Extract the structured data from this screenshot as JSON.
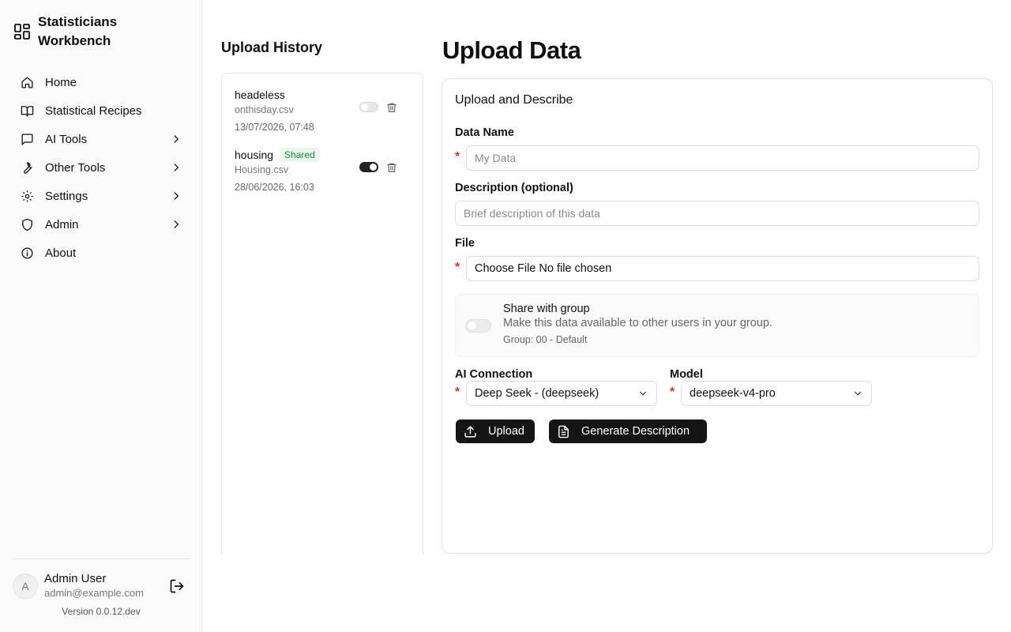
{
  "app": {
    "title": "Statisticians Workbench",
    "version": "Version 0.0.12.dev"
  },
  "sidebar": {
    "items": [
      {
        "label": "Home",
        "icon": "home-icon",
        "expandable": false
      },
      {
        "label": "Statistical Recipes",
        "icon": "book-icon",
        "expandable": false
      },
      {
        "label": "AI Tools",
        "icon": "chat-icon",
        "expandable": true
      },
      {
        "label": "Other Tools",
        "icon": "wrench-icon",
        "expandable": true
      },
      {
        "label": "Settings",
        "icon": "gear-icon",
        "expandable": true
      },
      {
        "label": "Admin",
        "icon": "shield-icon",
        "expandable": true
      },
      {
        "label": "About",
        "icon": "info-icon",
        "expandable": false
      }
    ]
  },
  "user": {
    "initial": "A",
    "name": "Admin User",
    "email": "admin@example.com"
  },
  "history": {
    "title": "Upload History",
    "items": [
      {
        "name": "headeless",
        "file": "onthisday.csv",
        "date": "13/07/2026, 07:48",
        "shared": false,
        "badge": ""
      },
      {
        "name": "housing",
        "file": "Housing.csv",
        "date": "28/06/2026, 16:03",
        "shared": true,
        "badge": "Shared"
      }
    ]
  },
  "main": {
    "title": "Upload Data",
    "card_title": "Upload and Describe",
    "data_name": {
      "label": "Data Name",
      "required_mark": "*",
      "placeholder": "My Data",
      "value": ""
    },
    "description": {
      "label": "Description (optional)",
      "placeholder": "Brief description of this data",
      "value": ""
    },
    "file": {
      "label": "File",
      "required_mark": "*",
      "button": "Choose File",
      "status": "No file chosen"
    },
    "share": {
      "title": "Share with group",
      "description": "Make this data available to other users in your group.",
      "group": "Group: 00 - Default",
      "enabled": false
    },
    "ai_connection": {
      "label": "AI Connection",
      "required_mark": "*",
      "value": "Deep Seek - (deepseek)"
    },
    "model": {
      "label": "Model",
      "required_mark": "*",
      "value": "deepseek-v4-pro"
    },
    "buttons": {
      "upload": "Upload",
      "generate": "Generate Description"
    }
  },
  "colors": {
    "accent": "#151515",
    "required": "#e0312b",
    "badge_bg": "#e8f6ec",
    "badge_text": "#1e8a43"
  }
}
